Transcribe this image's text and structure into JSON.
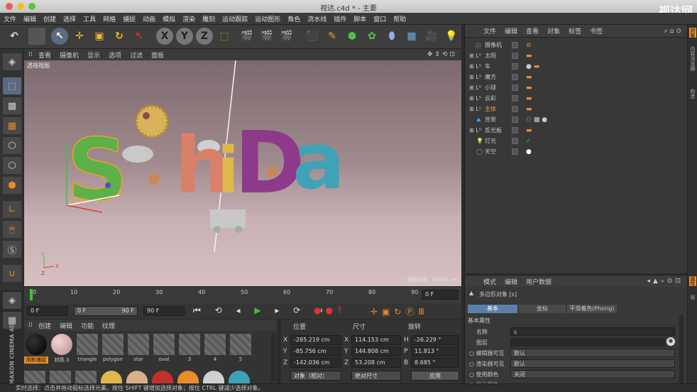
{
  "window": {
    "title": "视达.c4d * - 主要",
    "watermark": "视达网"
  },
  "menu": [
    "文件",
    "编辑",
    "创建",
    "选择",
    "工具",
    "网格",
    "捕捉",
    "动画",
    "模拟",
    "渲染",
    "雕刻",
    "运动跟踪",
    "运动图形",
    "角色",
    "流水线",
    "插件",
    "脚本",
    "窗口",
    "帮助"
  ],
  "viewport": {
    "menu": [
      "查看",
      "摄像机",
      "显示",
      "选项",
      "过滤",
      "面板"
    ],
    "label": "透视视图",
    "info": "网格间距：10000 cm",
    "scene_text": "ShiDa"
  },
  "timeline": {
    "ticks": [
      "0",
      "10",
      "20",
      "30",
      "40",
      "50",
      "60",
      "70",
      "80",
      "90"
    ],
    "frame_field": "0 F"
  },
  "playback": {
    "start": "0 F",
    "range_start": "0 F",
    "range_end": "90 F",
    "end": "90 F"
  },
  "materials": {
    "menu": [
      "创建",
      "编辑",
      "功能",
      "纹理"
    ],
    "items": [
      {
        "name": "阴影捕捉",
        "color": "#111111"
      },
      {
        "name": "材质.3",
        "color": "#d8b0b0"
      },
      {
        "name": "triangle",
        "color": ""
      },
      {
        "name": "polygon",
        "color": ""
      },
      {
        "name": "star",
        "color": ""
      },
      {
        "name": "oval",
        "color": ""
      },
      {
        "name": "3",
        "color": ""
      },
      {
        "name": "4",
        "color": ""
      },
      {
        "name": "5",
        "color": ""
      }
    ]
  },
  "coords": {
    "headers": {
      "pos": "位置",
      "size": "尺寸",
      "rot": "旋转"
    },
    "rows": [
      {
        "axis": "X",
        "pos": "-285.219 cm",
        "saxis": "X",
        "size": "114.153 cm",
        "raxis": "H",
        "rot": "-26.229 °"
      },
      {
        "axis": "Y",
        "pos": "-85.756 cm",
        "saxis": "Y",
        "size": "144.808 cm",
        "raxis": "P",
        "rot": "11.813 °"
      },
      {
        "axis": "Z",
        "pos": "-142.036 cm",
        "saxis": "Z",
        "size": "53.208 cm",
        "raxis": "B",
        "rot": "8.685 °"
      }
    ],
    "mode1": "对象（相对）",
    "mode2": "绝对尺寸",
    "apply": "应用"
  },
  "objects": {
    "menu": [
      "文件",
      "编辑",
      "查看",
      "对象",
      "标签",
      "书签"
    ],
    "items": [
      {
        "name": "摄像机",
        "color": "#d6d6d6"
      },
      {
        "name": "太阳",
        "color": "#d6d6d6"
      },
      {
        "name": "车",
        "color": "#d6d6d6"
      },
      {
        "name": "魔方",
        "color": "#d6d6d6"
      },
      {
        "name": "小球",
        "color": "#d6d6d6"
      },
      {
        "name": "云彩",
        "color": "#d6d6d6"
      },
      {
        "name": "主体",
        "color": "#e8a23a"
      },
      {
        "name": "背景",
        "color": "#d6d6d6"
      },
      {
        "name": "反光板",
        "color": "#d6d6d6"
      },
      {
        "name": "灯光",
        "color": "#d6d6d6"
      },
      {
        "name": "天空",
        "color": "#d6d6d6"
      }
    ]
  },
  "attributes": {
    "menu": [
      "模式",
      "编辑",
      "用户数据"
    ],
    "title": "多边形对象 [s]",
    "tabs": [
      "基本",
      "坐标",
      "平滑着色(Phong)"
    ],
    "section": "基本属性",
    "rows": [
      {
        "label": "名称",
        "value": "s"
      },
      {
        "label": "图层",
        "value": ""
      },
      {
        "label": "编辑器可见",
        "value": "默认"
      },
      {
        "label": "渲染器可见",
        "value": "默认"
      },
      {
        "label": "使用颜色",
        "value": "关闭"
      },
      {
        "label": "显示颜色",
        "value": ""
      }
    ]
  },
  "status": "实时选择：点击并拖动鼠标选择元素。按住 SHIFT 键增加选择对象；按住 CTRL 键减少选择对象。",
  "brand": "MAXON CINEMA 4D",
  "right_tabs": [
    "对象",
    "内容浏览器",
    "构造",
    "属性",
    "层"
  ]
}
